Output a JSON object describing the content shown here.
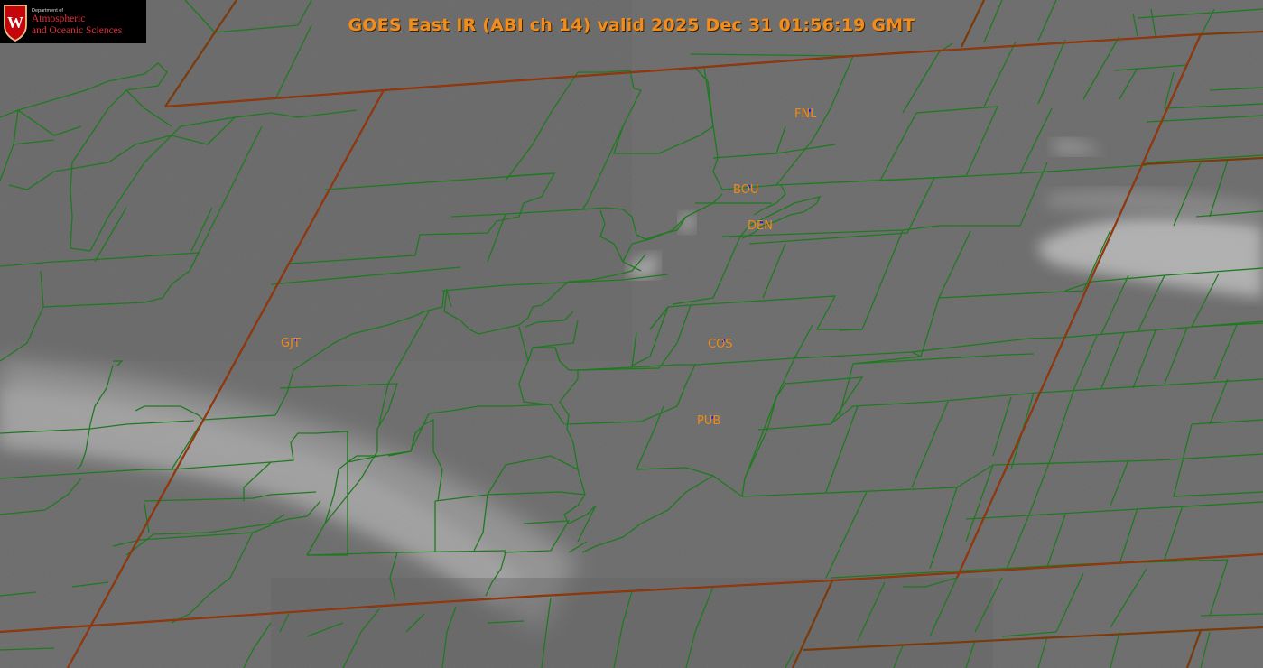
{
  "title": "GOES East IR (ABI ch 14) valid 2025 Dec 31 01:56:19 GMT",
  "logo": {
    "department": "Department of",
    "line1": "Atmospheric",
    "line2": "and Oceanic Sciences",
    "shield_letter": "W"
  },
  "stations": [
    {
      "id": "FNL"
    },
    {
      "id": "BOU"
    },
    {
      "id": "DEN"
    },
    {
      "id": "GJT"
    },
    {
      "id": "COS"
    },
    {
      "id": "PUB"
    }
  ],
  "colors": {
    "county_lines": "#1f7a1f",
    "state_lines": "#7a3a0a",
    "station_labels": "#f08a12",
    "station_markers": "#1a1aff",
    "title": "#f28c1a",
    "imagery_base": "#6e6e6e"
  }
}
